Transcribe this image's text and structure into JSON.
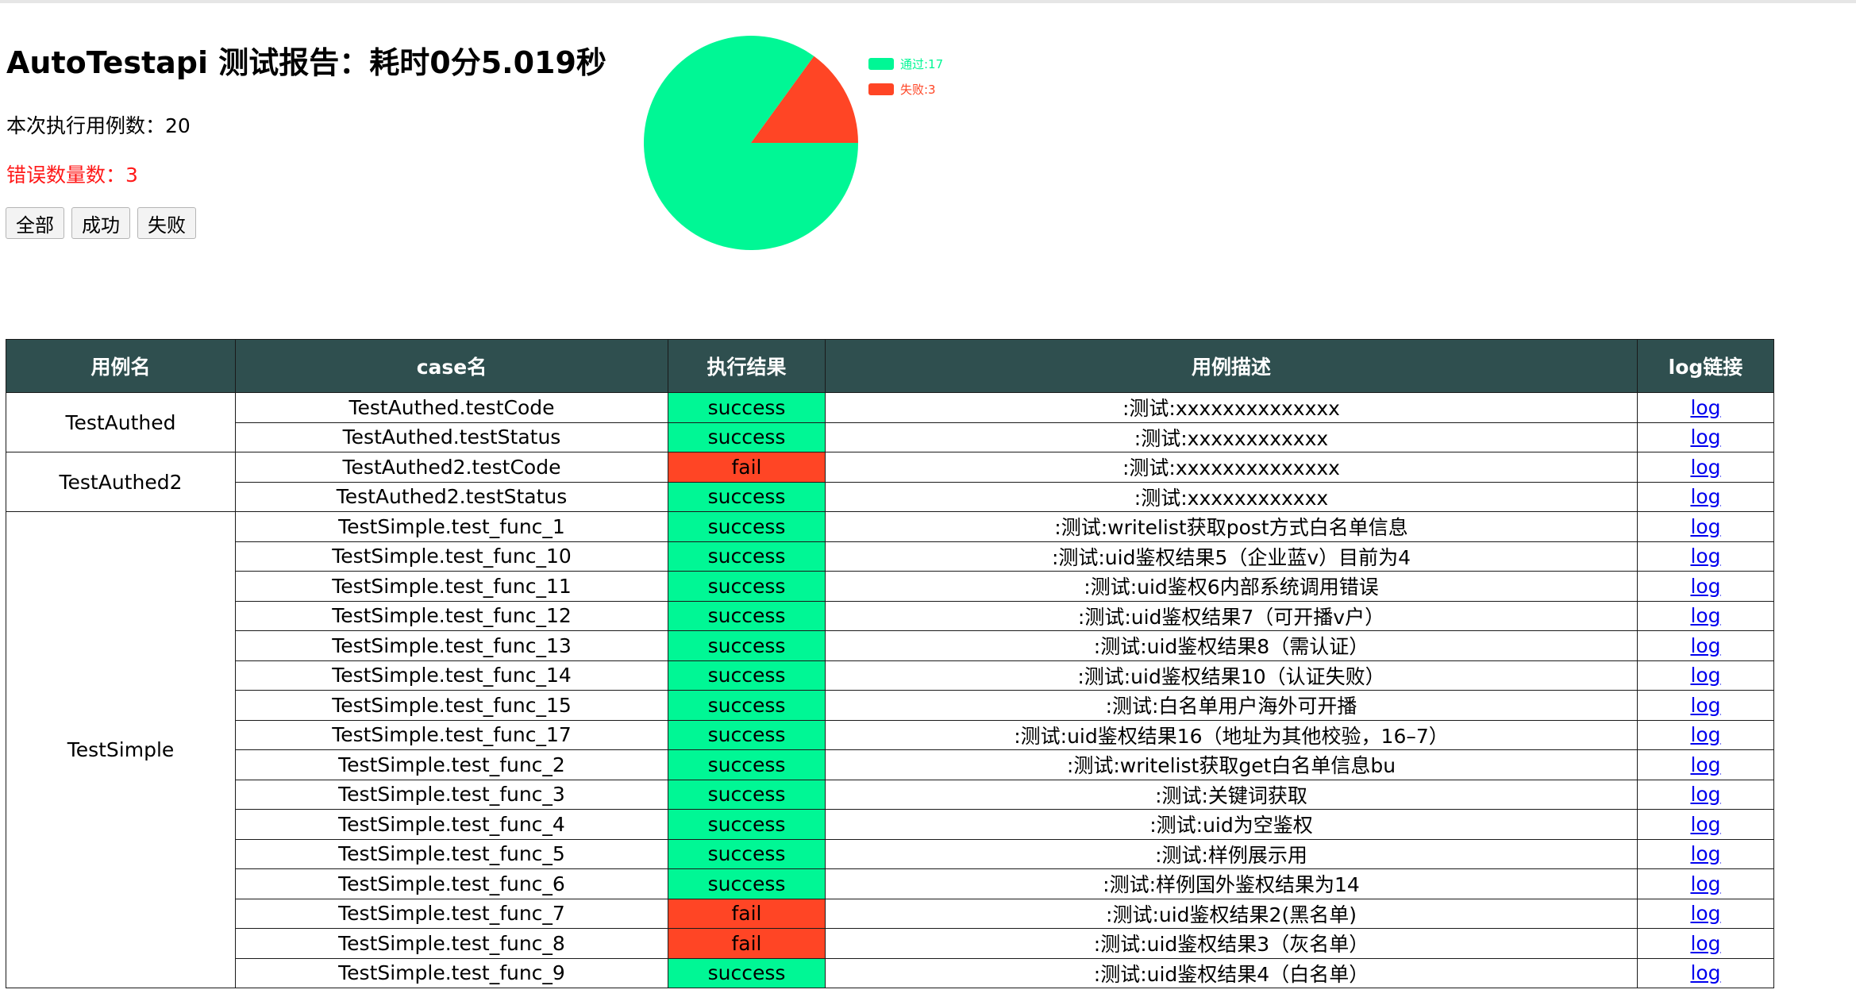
{
  "header": {
    "title": "AutoTestapi 测试报告：耗时0分5.019秒",
    "case_count_text": "本次执行用例数：20",
    "error_count_text": "错误数量数：3"
  },
  "filters": {
    "all_label": "全部",
    "success_label": "成功",
    "fail_label": "失败"
  },
  "chart_data": {
    "type": "pie",
    "categories": [
      "通过:17",
      "失败:3"
    ],
    "values": [
      17,
      3
    ],
    "colors": [
      "#00f795",
      "#ff4525"
    ],
    "legend_position": "top-right"
  },
  "colors": {
    "header_bg": "#2f4f4f",
    "success": "#00f795",
    "fail": "#ff4525",
    "error_text": "#ff1a1a",
    "link": "#0000ee"
  },
  "table": {
    "columns": [
      "用例名",
      "case名",
      "执行结果",
      "用例描述",
      "log链接"
    ],
    "groups": [
      {
        "name": "TestAuthed",
        "rows": [
          {
            "case": "TestAuthed.testCode",
            "result": "success",
            "desc": ":测试:xxxxxxxxxxxxxx",
            "log": "log"
          },
          {
            "case": "TestAuthed.testStatus",
            "result": "success",
            "desc": ":测试:xxxxxxxxxxxx",
            "log": "log"
          }
        ]
      },
      {
        "name": "TestAuthed2",
        "rows": [
          {
            "case": "TestAuthed2.testCode",
            "result": "fail",
            "desc": ":测试:xxxxxxxxxxxxxx",
            "log": "log"
          },
          {
            "case": "TestAuthed2.testStatus",
            "result": "success",
            "desc": ":测试:xxxxxxxxxxxx",
            "log": "log"
          }
        ]
      },
      {
        "name": "TestSimple",
        "rows": [
          {
            "case": "TestSimple.test_func_1",
            "result": "success",
            "desc": ":测试:writelist获取post方式白名单信息",
            "log": "log"
          },
          {
            "case": "TestSimple.test_func_10",
            "result": "success",
            "desc": ":测试:uid鉴权结果5（企业蓝v）目前为4",
            "log": "log"
          },
          {
            "case": "TestSimple.test_func_11",
            "result": "success",
            "desc": ":测试:uid鉴权6内部系统调用错误",
            "log": "log"
          },
          {
            "case": "TestSimple.test_func_12",
            "result": "success",
            "desc": ":测试:uid鉴权结果7（可开播v户）",
            "log": "log"
          },
          {
            "case": "TestSimple.test_func_13",
            "result": "success",
            "desc": ":测试:uid鉴权结果8（需认证）",
            "log": "log"
          },
          {
            "case": "TestSimple.test_func_14",
            "result": "success",
            "desc": ":测试:uid鉴权结果10（认证失败）",
            "log": "log"
          },
          {
            "case": "TestSimple.test_func_15",
            "result": "success",
            "desc": ":测试:白名单用户海外可开播",
            "log": "log"
          },
          {
            "case": "TestSimple.test_func_17",
            "result": "success",
            "desc": ":测试:uid鉴权结果16（地址为其他校验，16–7）",
            "log": "log"
          },
          {
            "case": "TestSimple.test_func_2",
            "result": "success",
            "desc": ":测试:writelist获取get白名单信息bu",
            "log": "log"
          },
          {
            "case": "TestSimple.test_func_3",
            "result": "success",
            "desc": ":测试:关键词获取",
            "log": "log"
          },
          {
            "case": "TestSimple.test_func_4",
            "result": "success",
            "desc": ":测试:uid为空鉴权",
            "log": "log"
          },
          {
            "case": "TestSimple.test_func_5",
            "result": "success",
            "desc": ":测试:样例展示用",
            "log": "log"
          },
          {
            "case": "TestSimple.test_func_6",
            "result": "success",
            "desc": ":测试:样例国外鉴权结果为14",
            "log": "log"
          },
          {
            "case": "TestSimple.test_func_7",
            "result": "fail",
            "desc": ":测试:uid鉴权结果2(黑名单)",
            "log": "log"
          },
          {
            "case": "TestSimple.test_func_8",
            "result": "fail",
            "desc": ":测试:uid鉴权结果3（灰名单）",
            "log": "log"
          },
          {
            "case": "TestSimple.test_func_9",
            "result": "success",
            "desc": ":测试:uid鉴权结果4（白名单）",
            "log": "log"
          }
        ]
      }
    ]
  }
}
